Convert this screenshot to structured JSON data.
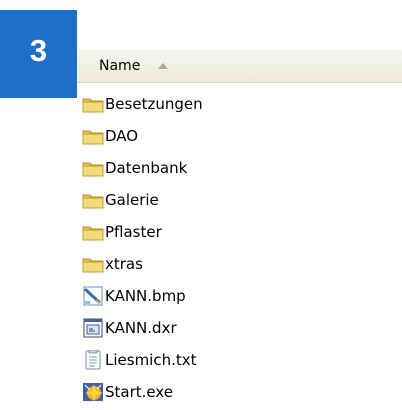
{
  "badge": {
    "number": "3",
    "color": "#1e6fc8"
  },
  "header": {
    "column_name": "Name",
    "sort_direction": "ascending"
  },
  "files": [
    {
      "name": "Besetzungen",
      "icon": "folder-icon"
    },
    {
      "name": "DAO",
      "icon": "folder-icon"
    },
    {
      "name": "Datenbank",
      "icon": "folder-icon"
    },
    {
      "name": "Galerie",
      "icon": "folder-icon"
    },
    {
      "name": "Pflaster",
      "icon": "folder-icon"
    },
    {
      "name": "xtras",
      "icon": "folder-icon"
    },
    {
      "name": "KANN.bmp",
      "icon": "bitmap-image-icon"
    },
    {
      "name": "KANN.dxr",
      "icon": "director-file-icon"
    },
    {
      "name": "Liesmich.txt",
      "icon": "text-document-icon"
    },
    {
      "name": "Start.exe",
      "icon": "application-exe-icon"
    }
  ]
}
